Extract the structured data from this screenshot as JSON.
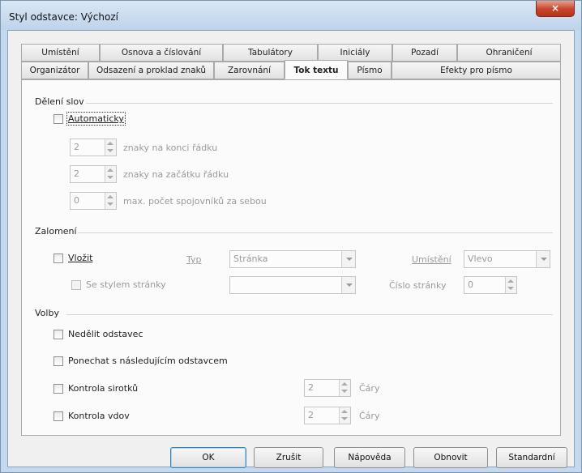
{
  "window": {
    "title": "Styl odstavce: Výchozí",
    "close_label": "×"
  },
  "tabs": {
    "back_row": [
      "Umístění",
      "Osnova a číslování",
      "Tabulátory",
      "Iniciály",
      "Pozadí",
      "Ohraničení"
    ],
    "front_row": [
      "Organizátor",
      "Odsazení a proklad znaků",
      "Zarovnání",
      "Tok textu",
      "Písmo",
      "Efekty pro písmo"
    ],
    "active": "Tok textu"
  },
  "hyphenation": {
    "section_title": "Dělení slov",
    "auto_label": "Automaticky",
    "auto_checked": false,
    "end_chars": {
      "value": "2",
      "label": "znaky na konci řádku"
    },
    "start_chars": {
      "value": "2",
      "label": "znaky na začátku řádku"
    },
    "max_hyphens": {
      "value": "0",
      "label": "max. počet spojovníků za sebou"
    }
  },
  "breaks": {
    "section_title": "Zalomení",
    "insert_label": "Vložit",
    "type_label": "Typ",
    "type_value": "Stránka",
    "position_label": "Umístění",
    "position_value": "Vlevo",
    "page_style_label": "Se stylem stránky",
    "page_style_value": "",
    "page_number_label": "Číslo stránky",
    "page_number_value": "0"
  },
  "options": {
    "section_title": "Volby",
    "keep_together_label": "Nedělit odstavec",
    "keep_next_label": "Ponechat s následujícím odstavcem",
    "orphan_label": "Kontrola sirotků",
    "orphan_value": "2",
    "orphan_unit": "Čáry",
    "widow_label": "Kontrola vdov",
    "widow_value": "2",
    "widow_unit": "Čáry"
  },
  "buttons": {
    "ok": "OK",
    "cancel": "Zrušit",
    "help": "Nápověda",
    "reset": "Obnovit",
    "standard": "Standardní"
  }
}
